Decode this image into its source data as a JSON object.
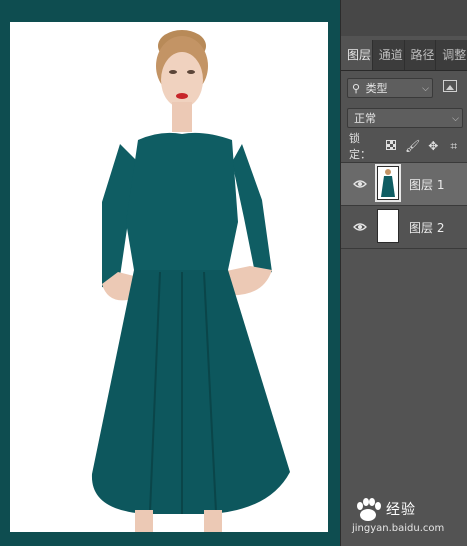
{
  "panel": {
    "tabs": [
      {
        "label": "图层",
        "active": true
      },
      {
        "label": "通道",
        "active": false
      },
      {
        "label": "路径",
        "active": false
      },
      {
        "label": "调整",
        "active": false
      }
    ],
    "filter": {
      "kind_label": "类型"
    },
    "blend_mode": "正常",
    "lock_label": "锁定：",
    "layers": [
      {
        "name": "图层 1",
        "selected": true,
        "visible": true
      },
      {
        "name": "图层 2",
        "selected": false,
        "visible": true
      }
    ]
  },
  "watermark": {
    "brand": "经验",
    "url": "jingyan.baidu.com"
  },
  "colors": {
    "canvas_bg": "#0e4d50",
    "panel_bg": "#535353",
    "dress": "#0f5d63",
    "selected_row": "#6a6a6a"
  }
}
